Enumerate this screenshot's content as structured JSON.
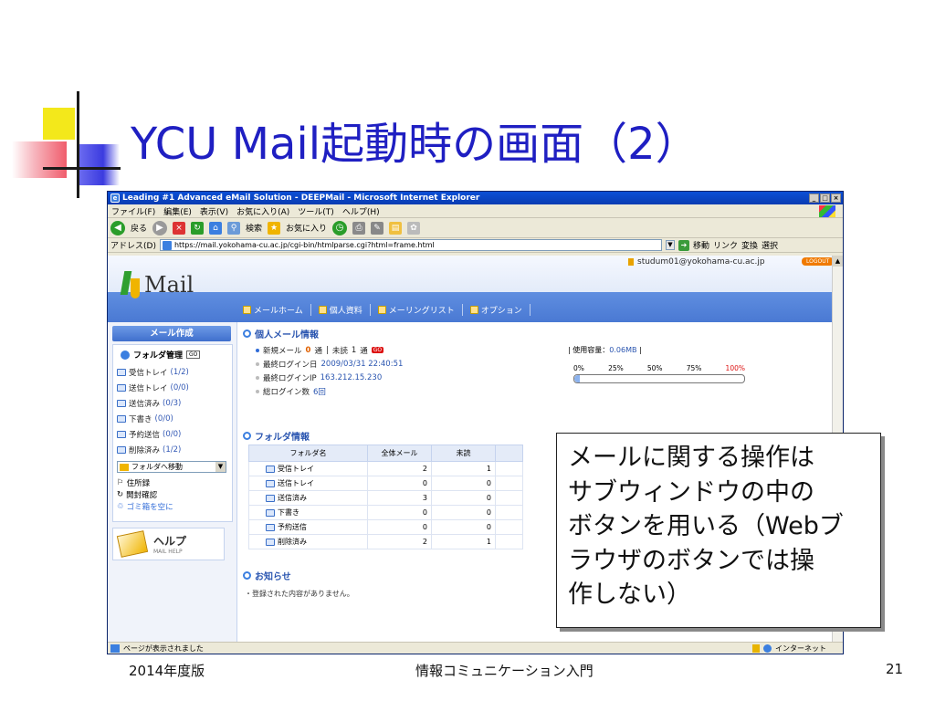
{
  "slide": {
    "title": "YCU Mail起動時の画面（2）",
    "footer_left": "2014年度版",
    "footer_center": "情報コミュニケーション入門",
    "page_number": "21",
    "callout_lines": [
      "メールに関する操作は",
      "サブウィンドウの中の",
      "ボタンを用いる（Webブ",
      "ラウザのボタンでは操",
      "作しない）"
    ]
  },
  "browser": {
    "title": "Leading #1 Advanced eMail Solution - DEEPMail - Microsoft Internet Explorer",
    "menu": [
      "ファイル(F)",
      "編集(E)",
      "表示(V)",
      "お気に入り(A)",
      "ツール(T)",
      "ヘルプ(H)"
    ],
    "toolbar": {
      "back": "戻る",
      "search": "検索",
      "favorites": "お気に入り"
    },
    "address_label": "アドレス(D)",
    "url": "https://mail.yokohama-cu.ac.jp/cgi-bin/htmlparse.cgi?html=frame.html",
    "go": "移動",
    "links": "リンク",
    "convert": "変換",
    "select": "選択",
    "status": "ページが表示されました",
    "zone": "インターネット"
  },
  "webmail": {
    "logo_text": "Mail",
    "user": "studum01@yokohama-cu.ac.jp",
    "logout": "LOGOUT",
    "nav_tabs": [
      "メールホーム",
      "個人資料",
      "メーリングリスト",
      "オプション"
    ],
    "compose": "メール作成",
    "folder_manage": "フォルダ管理",
    "folder_manage_btn": "GO",
    "folders": [
      {
        "name": "受信トレイ",
        "count": "(1/2)"
      },
      {
        "name": "送信トレイ",
        "count": "(0/0)"
      },
      {
        "name": "送信済み",
        "count": "(0/3)"
      },
      {
        "name": "下書き",
        "count": "(0/0)"
      },
      {
        "name": "予約送信",
        "count": "(0/0)"
      },
      {
        "name": "削除済み",
        "count": "(1/2)"
      }
    ],
    "move_select": "フォルダへ移動",
    "address_book": "住所録",
    "read_check": "開封確認",
    "empty_trash": "ゴミ箱を空に",
    "help_title": "ヘルプ",
    "help_sub": "MAIL HELP",
    "personal_info_head": "個人メール情報",
    "new_mail_label": "新規メール",
    "new_mail_count": "0",
    "new_mail_unit": "通",
    "unread_label": "未読",
    "unread_count": "1",
    "unread_unit": "通",
    "new_badge": "GO",
    "last_login_label": "最終ログイン日",
    "last_login_value": "2009/03/31 22:40:51",
    "last_ip_label": "最終ログインIP",
    "last_ip_value": "163.212.15.230",
    "login_count_label": "総ログイン数",
    "login_count_value": "6回",
    "usage_label": "使用容量：",
    "usage_value": "0.06MB",
    "usage_ratio": 0.01,
    "usage_scale": [
      "0%",
      "25%",
      "50%",
      "75%",
      "100%"
    ],
    "folder_info_head": "フォルダ情報",
    "table_headers": [
      "フォルダ名",
      "全体メール",
      "未読"
    ],
    "table_rows": [
      {
        "name": "受信トレイ",
        "total": "2",
        "unread": "1"
      },
      {
        "name": "送信トレイ",
        "total": "0",
        "unread": "0"
      },
      {
        "name": "送信済み",
        "total": "3",
        "unread": "0"
      },
      {
        "name": "下書き",
        "total": "0",
        "unread": "0"
      },
      {
        "name": "予約送信",
        "total": "0",
        "unread": "0"
      },
      {
        "name": "削除済み",
        "total": "2",
        "unread": "1"
      }
    ],
    "notice_head": "お知らせ",
    "notice_text": "・登録された内容がありません。"
  }
}
